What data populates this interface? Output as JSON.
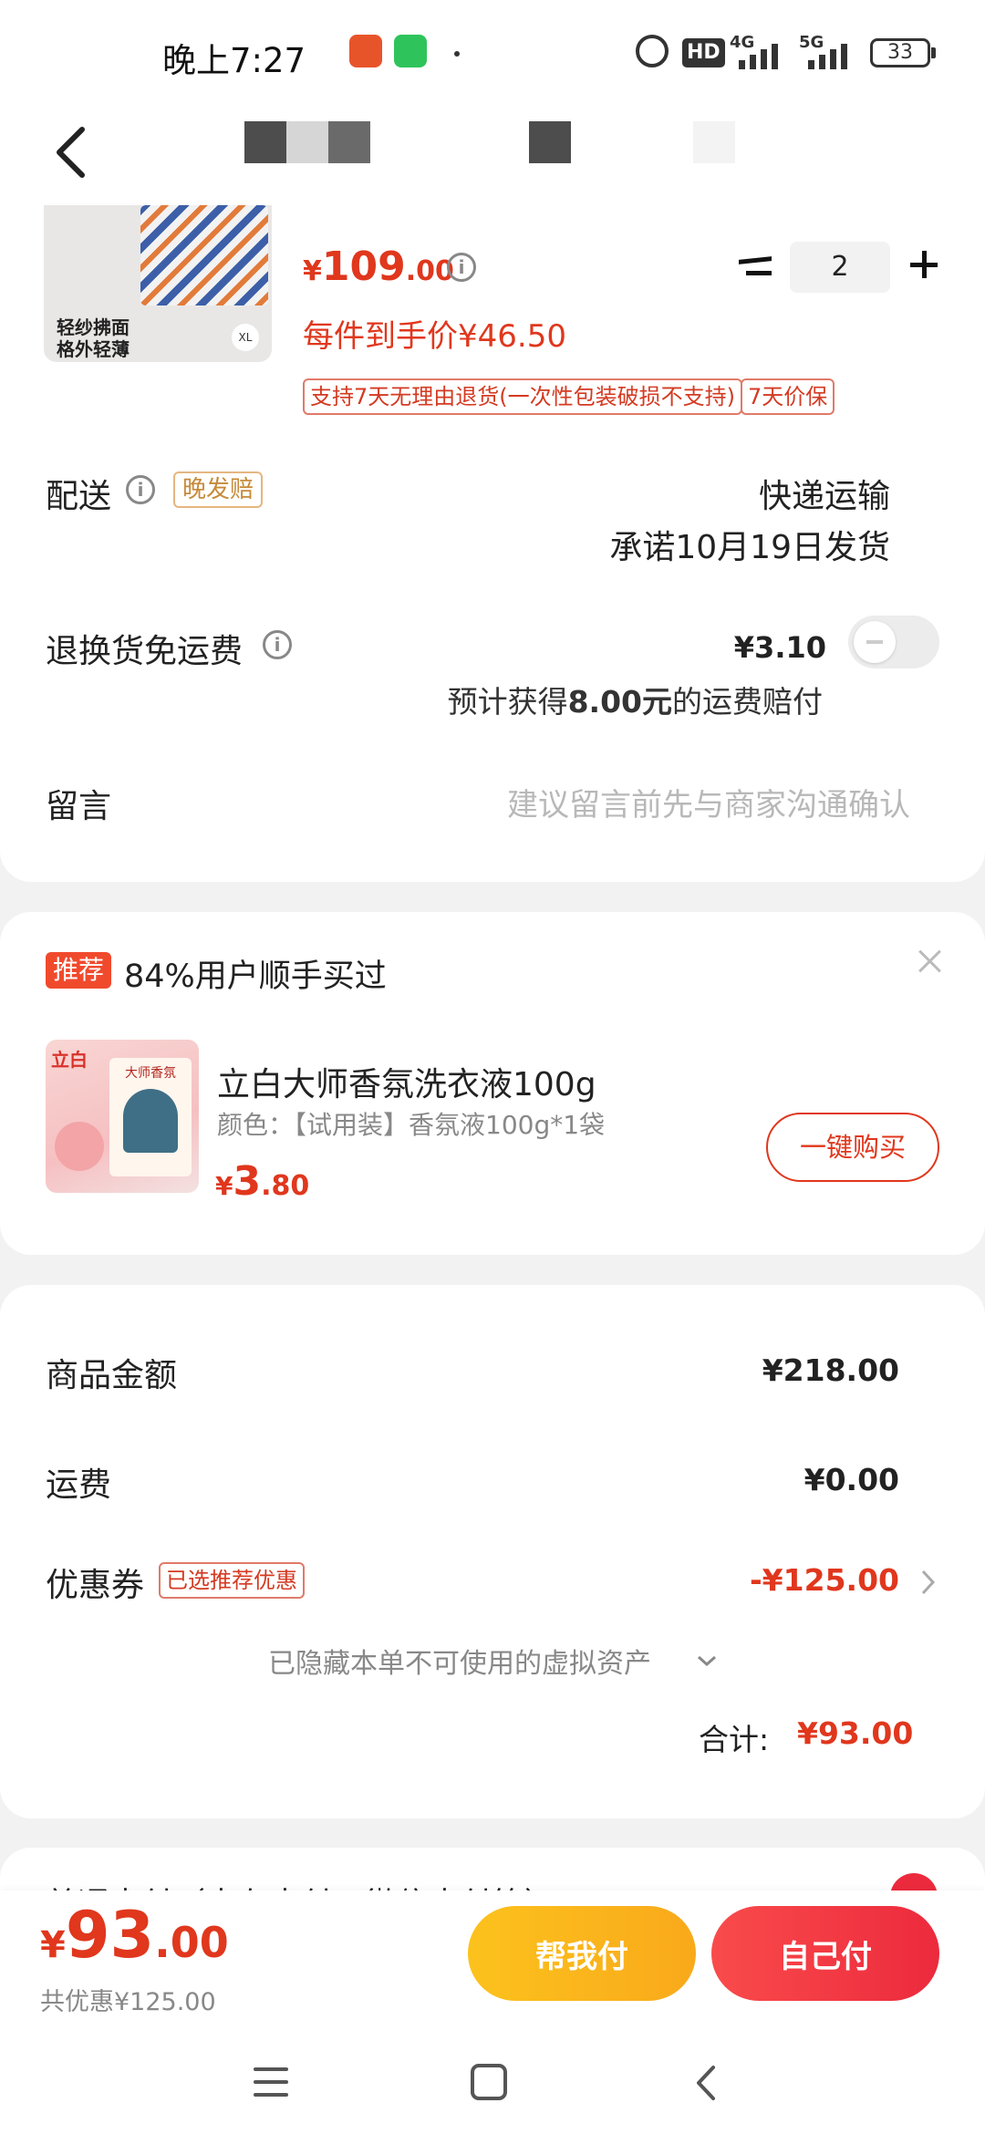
{
  "status_bar": {
    "time": "晚上7:27",
    "signal_labels": [
      "HD",
      "4G",
      "5G"
    ],
    "battery": "33"
  },
  "product": {
    "image_caption_line1": "轻纱拂面",
    "image_caption_line2": "格外轻薄",
    "image_size_badge": "XL",
    "price_symbol": "¥",
    "price_int": "109",
    "price_dec": ".00",
    "per_item_price": "每件到手价¥46.50",
    "quantity": "2",
    "tag_return": "支持7天无理由退货(一次性包装破损不支持)",
    "tag_price_protect": "7天价保"
  },
  "delivery": {
    "label": "配送",
    "late_tag": "晚发赔",
    "method": "快递运输",
    "promise": "承诺10月19日发货"
  },
  "return_shipping": {
    "label": "退换货免运费",
    "price": "¥3.10",
    "note_prefix": "预计获得",
    "note_amount": "8.00元",
    "note_suffix": "的运费赔付"
  },
  "message": {
    "label": "留言",
    "placeholder": "建议留言前先与商家沟通确认"
  },
  "recommend": {
    "badge": "推荐",
    "title": "84%用户顺手买过",
    "item_title": "立白大师香氛洗衣液100g",
    "item_spec": "颜色：【试用装】香氛液100g*1袋",
    "price_symbol": "¥",
    "price_int": "3",
    "price_dec": ".80",
    "buy_button": "一键购买",
    "thumb_brand": "立白",
    "thumb_name": "大师香氛"
  },
  "summary": {
    "goods_label": "商品金额",
    "goods_value": "¥218.00",
    "shipping_label": "运费",
    "shipping_value": "¥0.00",
    "coupon_label": "优惠券",
    "coupon_tag": "已选推荐优惠",
    "coupon_value": "-¥125.00",
    "hidden_assets": "已隐藏本单不可使用的虚拟资产",
    "total_label": "合计:",
    "total_value": "¥93.00"
  },
  "payment": {
    "partial_text": "普通支付（支存支付，微信支付等）"
  },
  "bottom": {
    "price_symbol": "¥",
    "price_int": "93",
    "price_dec": ".00",
    "discount_note": "共优惠¥125.00",
    "help_pay": "帮我付",
    "self_pay": "自己付"
  },
  "colors": {
    "accent_red": "#e0371d",
    "button_yellow": "#fcc21c",
    "button_red": "#f0344a"
  }
}
